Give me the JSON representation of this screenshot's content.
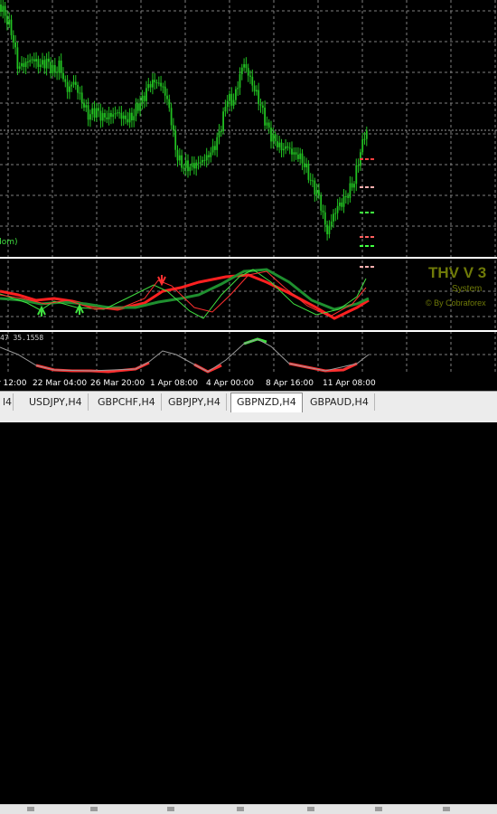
{
  "chart": {
    "x_axis_labels": [
      "r 12:00",
      "22 Mar 04:00",
      "26 Mar 20:00",
      "1 Apr 08:00",
      "4 Apr 00:00",
      "8 Apr 16:00",
      "11 Apr 08:00"
    ],
    "legend_fragment": "dom)",
    "watermark": {
      "title": "THV V 3",
      "subtitle": "System",
      "credit": "© By Cobraforex"
    },
    "sub_indicator_values": "47 35.1558",
    "colors": {
      "background": "#000000",
      "grid": "#7f7f7f",
      "candles": "#22c022",
      "fast_line": "#ff2020",
      "slow_line": "#1f8f2f",
      "thin_red": "#ff3030",
      "thin_green": "#40e040",
      "watermark": "#6f7a08",
      "separator": "#ffffff"
    }
  },
  "tabs": [
    {
      "label": "l4",
      "active": false
    },
    {
      "label": "USDJPY,H4",
      "active": false
    },
    {
      "label": "GBPCHF,H4",
      "active": false
    },
    {
      "label": "GBPJPY,H4",
      "active": false
    },
    {
      "label": "GBPNZD,H4",
      "active": true
    },
    {
      "label": "GBPAUD,H4",
      "active": false
    }
  ]
}
